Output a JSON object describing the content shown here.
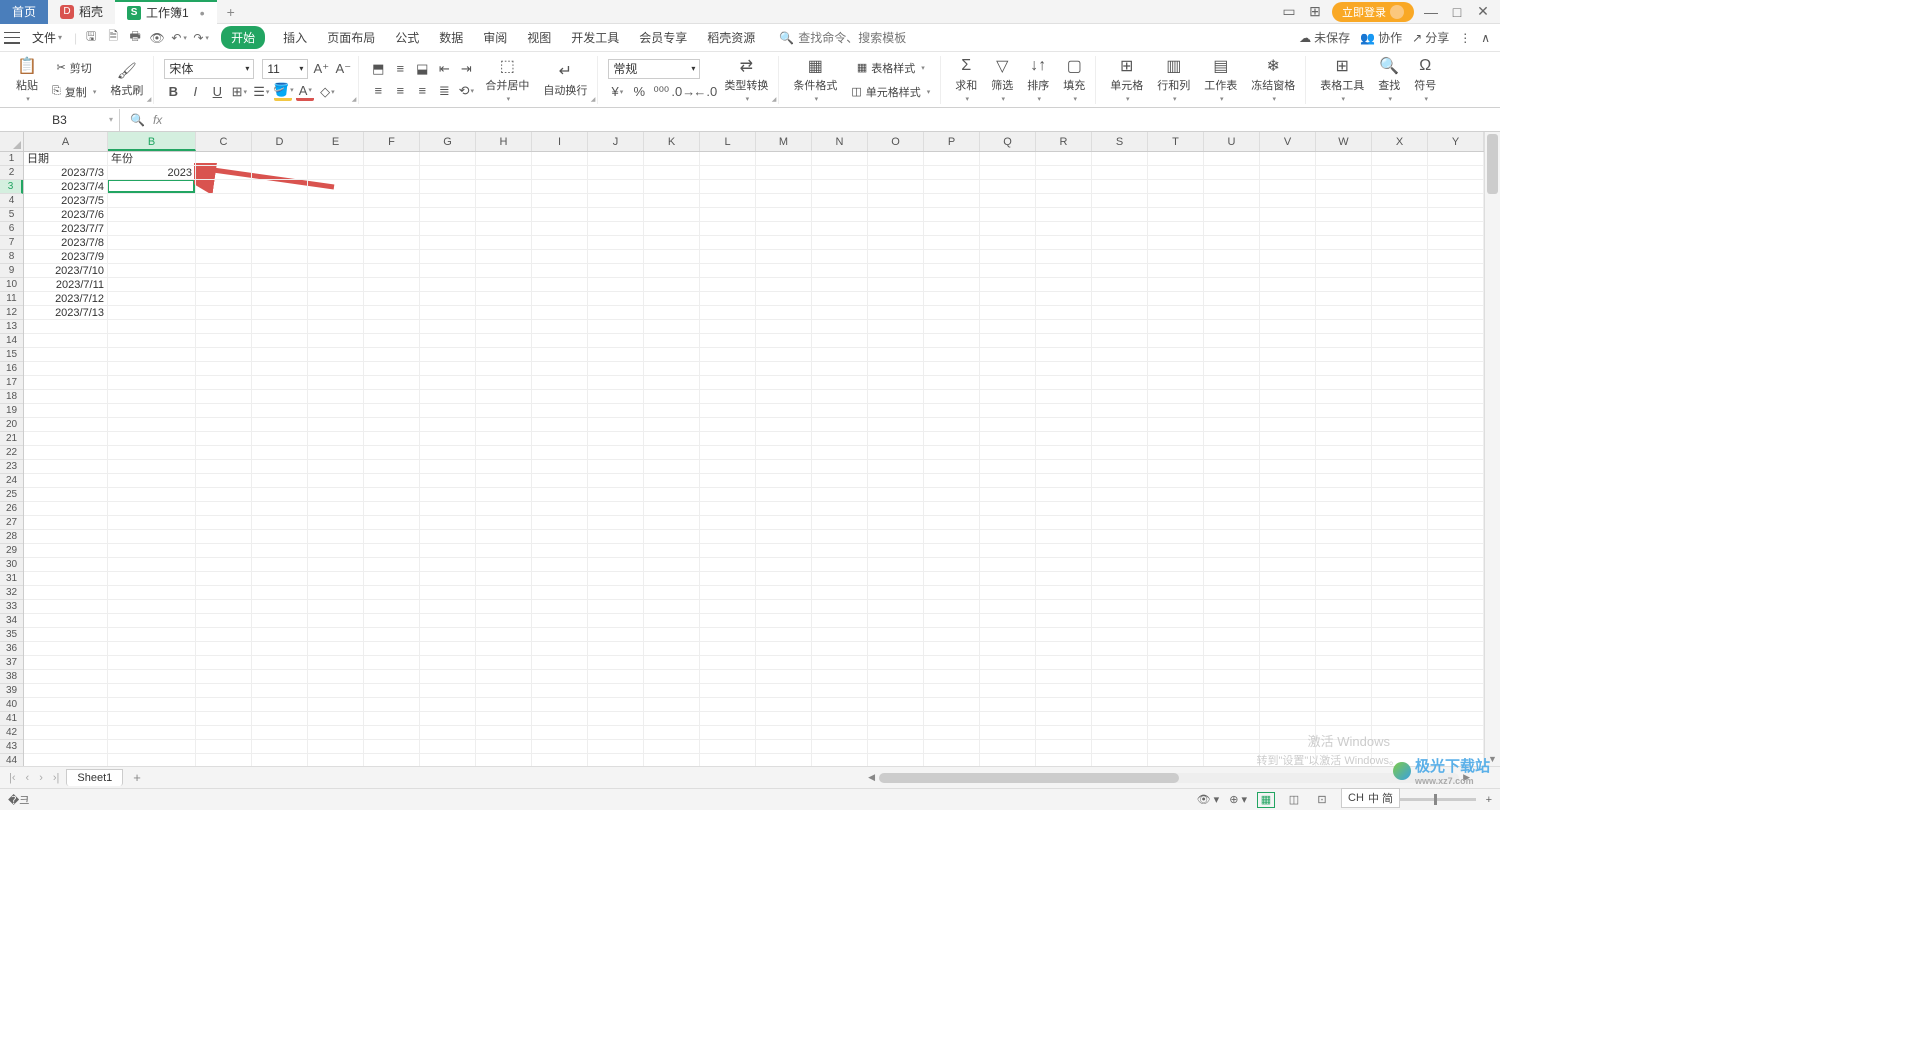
{
  "titlebar": {
    "home_tab": "首页",
    "tab2": "稻壳",
    "tab3": "工作簿1",
    "login": "立即登录"
  },
  "menubar": {
    "file": "文件",
    "tabs": [
      "开始",
      "插入",
      "页面布局",
      "公式",
      "数据",
      "审阅",
      "视图",
      "开发工具",
      "会员专享",
      "稻壳资源"
    ],
    "search_placeholder": "查找命令、搜索模板",
    "unsaved": "未保存",
    "collab": "协作",
    "share": "分享"
  },
  "ribbon": {
    "paste": "粘贴",
    "cut": "剪切",
    "copy": "复制",
    "format_painter": "格式刷",
    "font_name": "宋体",
    "font_size": "11",
    "merge": "合并居中",
    "wrap": "自动换行",
    "number_format": "常规",
    "type_convert": "类型转换",
    "cond_fmt": "条件格式",
    "table_style": "表格样式",
    "cell_style": "单元格样式",
    "sum": "求和",
    "filter": "筛选",
    "sort": "排序",
    "fill": "填充",
    "cell": "单元格",
    "rowcol": "行和列",
    "worksheet": "工作表",
    "freeze": "冻结窗格",
    "table_tools": "表格工具",
    "find": "查找",
    "symbol": "符号"
  },
  "namebox": "B3",
  "columns": [
    "A",
    "B",
    "C",
    "D",
    "E",
    "F",
    "G",
    "H",
    "I",
    "J",
    "K",
    "L",
    "M",
    "N",
    "O",
    "P",
    "Q",
    "R",
    "S",
    "T",
    "U",
    "V",
    "W",
    "X",
    "Y"
  ],
  "col_widths": {
    "A": 84,
    "B": 88,
    "default": 56
  },
  "active_col": "B",
  "active_row": 3,
  "row_count": 44,
  "cells": {
    "A1": "日期",
    "B1": "年份",
    "A2": "2023/7/3",
    "B2": "2023",
    "A3": "2023/7/4",
    "A4": "2023/7/5",
    "A5": "2023/7/6",
    "A6": "2023/7/7",
    "A7": "2023/7/8",
    "A8": "2023/7/9",
    "A9": "2023/7/10",
    "A10": "2023/7/11",
    "A11": "2023/7/12",
    "A12": "2023/7/13"
  },
  "sheet": "Sheet1",
  "zoom": "100%",
  "watermark": {
    "line1": "激活 Windows",
    "line2": "转到\"设置\"以激活 Windows。"
  },
  "brand": {
    "name": "极光下载站",
    "url": "www.xz7.com"
  },
  "ime": {
    "lang": "CH",
    "mode": "中 简"
  }
}
